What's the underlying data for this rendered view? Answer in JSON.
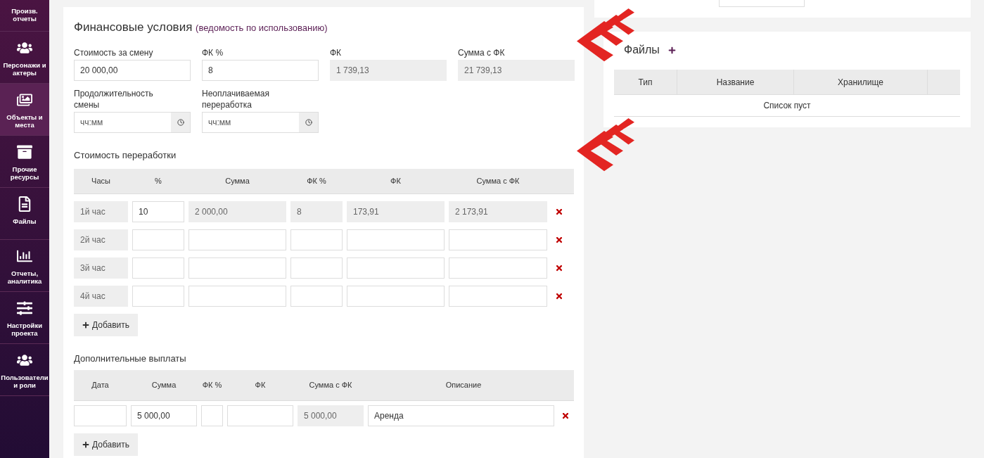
{
  "sidebar": {
    "items": [
      {
        "label": "Произв. отчеты",
        "selected": false
      },
      {
        "label": "Персонажи и актеры",
        "selected": false
      },
      {
        "label": "Объекты и места",
        "selected": true
      },
      {
        "label": "Прочие ресурсы",
        "selected": false
      },
      {
        "label": "Файлы",
        "selected": false
      },
      {
        "label": "Отчеты, аналитика",
        "selected": false
      },
      {
        "label": "Настройки проекта",
        "selected": false
      },
      {
        "label": "Пользователи и роли",
        "selected": false
      }
    ]
  },
  "finance": {
    "title": "Финансовые условия",
    "subtitle": "(ведомость по использованию)",
    "fields": [
      {
        "label": "Стоимость за смену",
        "value": "20 000,00",
        "readonly": false
      },
      {
        "label": "ФК %",
        "value": "8",
        "readonly": false
      },
      {
        "label": "ФК",
        "value": "1 739,13",
        "readonly": true
      },
      {
        "label": "Сумма с ФК",
        "value": "21 739,13",
        "readonly": true
      }
    ],
    "time_fields": [
      {
        "label": "Продолжительность смены",
        "placeholder": "чч:мм"
      },
      {
        "label": "Неоплачиваемая переработка",
        "placeholder": "чч:мм"
      }
    ]
  },
  "overtime": {
    "title": "Стоимость переработки",
    "columns": [
      "Часы",
      "%",
      "Сумма",
      "ФК %",
      "ФК",
      "Сумма с ФК"
    ],
    "rows": [
      [
        {
          "value": "1й час",
          "readonly": true
        },
        {
          "value": "10",
          "readonly": false
        },
        {
          "value": "2 000,00",
          "readonly": true
        },
        {
          "value": "8",
          "readonly": true
        },
        {
          "value": "173,91",
          "readonly": true
        },
        {
          "value": "2 173,91",
          "readonly": true
        }
      ],
      [
        {
          "value": "2й час",
          "readonly": true
        },
        {
          "readonly": false
        },
        {
          "readonly": false
        },
        {
          "readonly": false
        },
        {
          "readonly": false
        },
        {
          "readonly": false
        }
      ],
      [
        {
          "value": "3й час",
          "readonly": true
        },
        {
          "readonly": false
        },
        {
          "readonly": false
        },
        {
          "readonly": false
        },
        {
          "readonly": false
        },
        {
          "readonly": false
        }
      ],
      [
        {
          "value": "4й час",
          "readonly": true
        },
        {
          "readonly": false
        },
        {
          "readonly": false
        },
        {
          "readonly": false
        },
        {
          "readonly": false
        },
        {
          "readonly": false
        }
      ]
    ],
    "add_button": "Добавить"
  },
  "extra": {
    "title": "Дополнительные выплаты",
    "columns": [
      "Дата",
      "Сумма",
      "ФК %",
      "ФК",
      "Сумма с ФК",
      "Описание"
    ],
    "rows": [
      [
        {
          "readonly": false
        },
        {
          "value": "5 000,00",
          "readonly": false
        },
        {
          "readonly": false
        },
        {
          "readonly": false
        },
        {
          "value": "5 000,00",
          "readonly": true
        },
        {
          "value": "Аренда",
          "readonly": false
        }
      ]
    ],
    "add_button": "Добавить"
  },
  "files": {
    "title": "Файлы",
    "columns": [
      "Тип",
      "Название",
      "Хранилище"
    ],
    "empty_text": "Список пуст"
  }
}
